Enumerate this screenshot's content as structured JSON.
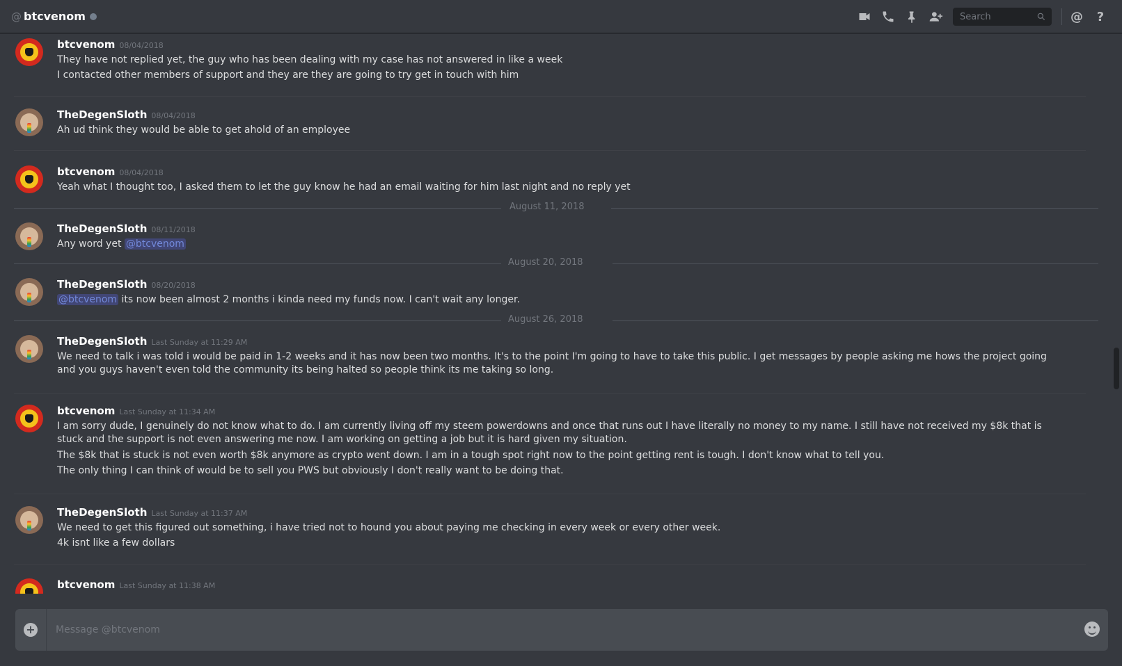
{
  "header": {
    "at_symbol": "@",
    "title": "btcvenom",
    "search_placeholder": "Search",
    "mention_icon": "@",
    "help_icon": "?"
  },
  "messages": [
    {
      "author": "btcvenom",
      "timestamp": "08/04/2018",
      "avatar": "venom",
      "lines": [
        "They have not replied yet, the guy who has been dealing with my case has not answered in like a week",
        "I contacted other members of support and they are they are going to try get in touch with him"
      ]
    },
    {
      "author": "TheDegenSloth",
      "timestamp": "08/04/2018",
      "avatar": "sloth",
      "lines": [
        "Ah ud think they would be able to get ahold of an employee"
      ]
    },
    {
      "author": "btcvenom",
      "timestamp": "08/04/2018",
      "avatar": "venom",
      "lines": [
        "Yeah what I thought too, I asked them to let the guy know he had an email waiting for him last night and no reply yet"
      ]
    },
    {
      "date_separator": "August 11, 2018"
    },
    {
      "author": "TheDegenSloth",
      "timestamp": "08/11/2018",
      "avatar": "sloth",
      "lines": [
        "Any word yet"
      ],
      "mention_after": "@btcvenom"
    },
    {
      "date_separator": "August 20, 2018"
    },
    {
      "author": "TheDegenSloth",
      "timestamp": "08/20/2018",
      "avatar": "sloth",
      "mention_before": "@btcvenom",
      "lines": [
        "its now been almost 2 months i kinda need my funds now. I can't wait any longer."
      ]
    },
    {
      "date_separator": "August 26, 2018"
    },
    {
      "author": "TheDegenSloth",
      "timestamp": "Last Sunday at 11:29 AM",
      "avatar": "sloth",
      "lines": [
        "We need to talk i was told i would be paid in 1-2 weeks and it has now been two months. It's to the point I'm going to have to take this public. I get messages by people asking me hows the project going and you guys haven't even told the community its being halted so people think its me taking so long."
      ]
    },
    {
      "author": "btcvenom",
      "timestamp": "Last Sunday at 11:34 AM",
      "avatar": "venom",
      "lines": [
        "I am sorry dude, I genuinely do not know what to do. I am currently living off my steem powerdowns and once that runs out I have literally no money to my name. I still have not received my $8k that is stuck and the support is not even answering me now.  I am working on getting a job but it is hard given my situation.",
        "The $8k that is stuck is not even worth $8k anymore as crypto went down. I am in a tough spot right now to the point getting rent is tough. I don't know what to tell you.",
        "The only thing I can think of would be to sell you PWS but obviously I don't really want to be doing that."
      ]
    },
    {
      "author": "TheDegenSloth",
      "timestamp": "Last Sunday at 11:37 AM",
      "avatar": "sloth",
      "lines": [
        "We need to get this figured out something, i have tried not to hound you about paying me checking in every week or every other week.",
        "4k isnt like a few dollars"
      ]
    },
    {
      "author": "btcvenom",
      "timestamp": "Last Sunday at 11:38 AM",
      "avatar": "venom",
      "lines": []
    }
  ],
  "composer": {
    "placeholder": "Message @btcvenom"
  },
  "colors": {
    "background": "#36393f",
    "mention": "#7289da",
    "venom_avatar": "#d32a1e"
  }
}
